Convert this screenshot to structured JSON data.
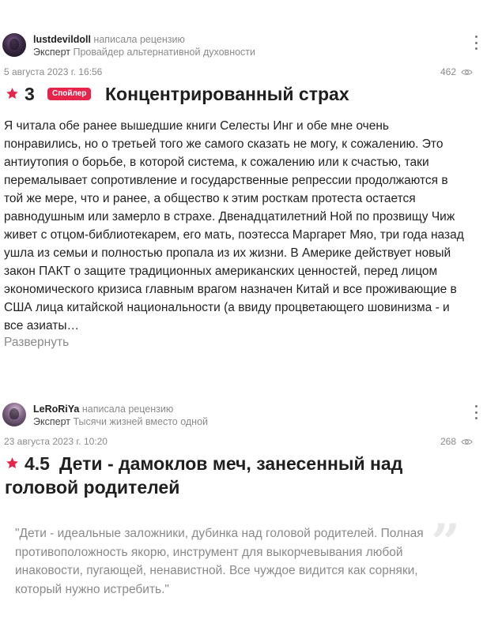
{
  "icons": {
    "star": "star-icon",
    "eye": "eye-icon",
    "menu": "kebab-menu-icon",
    "quote": "quote-mark-icon"
  },
  "colors": {
    "accent": "#e6254b",
    "muted": "#8a8a8a",
    "text": "#222222"
  },
  "reviews": [
    {
      "username": "lustdevildoll",
      "action": "написала рецензию",
      "expert_label": "Эксперт",
      "expert_topic": "Провайдер альтернативной духовности",
      "date": "5 августа 2023 г. 16:56",
      "views": "462",
      "rating": "3",
      "spoiler": "Спойлер",
      "title": "Концентрированный страх",
      "text": "Я читала обе ранее вышедшие книги Селесты Инг и обе мне очень понравились, но о третьей того же самого сказать не могу, к сожалению. Это антиутопия о борьбе, в которой система, к сожалению или к счастью, таки перемалывает сопротивление и государственные репрессии продолжаются в той же мере, что и ранее, а общество к этим росткам протеста остается равнодушным или замерло в страхе. Двенадцатилетний Ной по прозвищу Чиж живет с отцом-библиотекарем, его мать, поэтесса Маргарет Мяо, три года назад ушла из семьи и полностью пропала из их жизни. В Америке действует новый закон ПАКТ о защите традиционных американских ценностей, перед лицом экономического кризиса главным врагом назначен Китай и все проживающие в США лица китайской национальности (а ввиду процветающего шовинизма - и все азиаты…",
      "expand": "Развернуть"
    },
    {
      "username": "LeRoRiYa",
      "action": "написала рецензию",
      "expert_label": "Эксперт",
      "expert_topic": "Тысячи жизней вместо одной",
      "date": "23 августа 2023 г. 10:20",
      "views": "268",
      "rating": "4.5",
      "title": "Дети - дамоклов меч, занесенный над головой родителей",
      "quote": "\"Дети - идеальные заложники, дубинка над головой родителей. Полная противоположность якорю, инструмент для выкорчевывания любой инаковости, пугающей, ненавистной. Все чуждое видится как сорняки, который нужно истребить.\""
    }
  ]
}
